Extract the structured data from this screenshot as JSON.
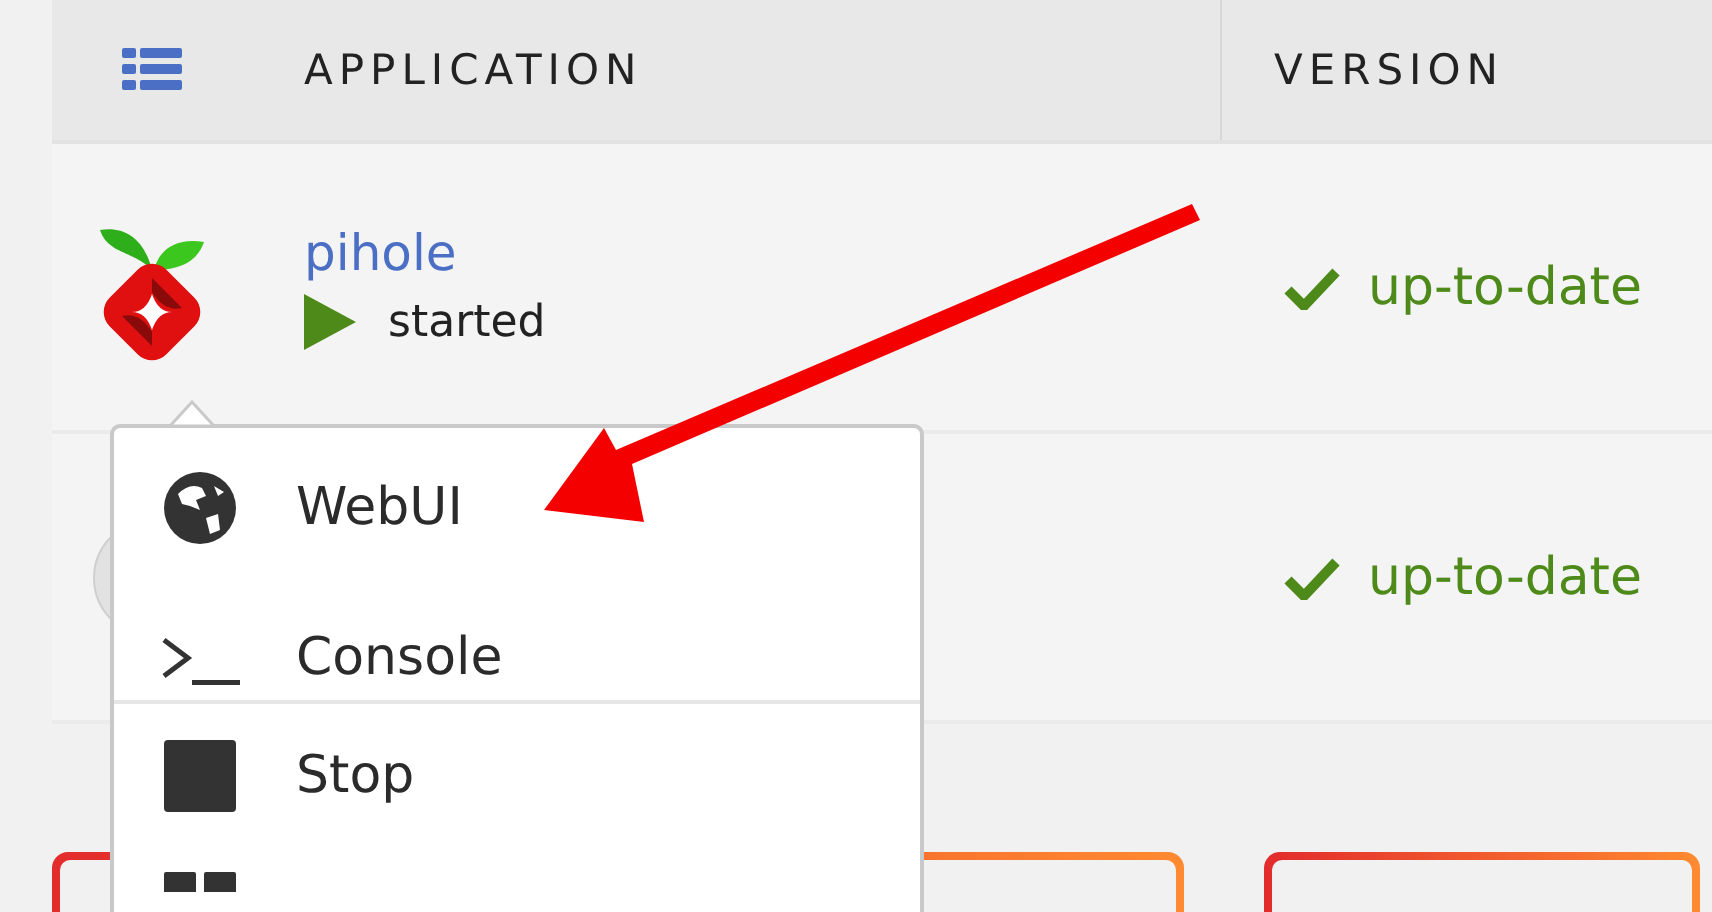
{
  "table": {
    "columns": [
      {
        "label": "APPLICATION"
      },
      {
        "label": "VERSION"
      }
    ],
    "rows": [
      {
        "name": "pihole",
        "status": "started",
        "version": "up-to-date"
      },
      {
        "version": "up-to-date"
      }
    ]
  },
  "menu": {
    "items": [
      {
        "kind": "item",
        "label": "WebUI"
      },
      {
        "kind": "item",
        "label": "Console"
      },
      {
        "kind": "divider"
      },
      {
        "kind": "item",
        "label": "Stop"
      },
      {
        "kind": "item"
      }
    ]
  },
  "cards": [
    {
      "kind": "card"
    },
    {
      "kind": "card"
    }
  ]
}
